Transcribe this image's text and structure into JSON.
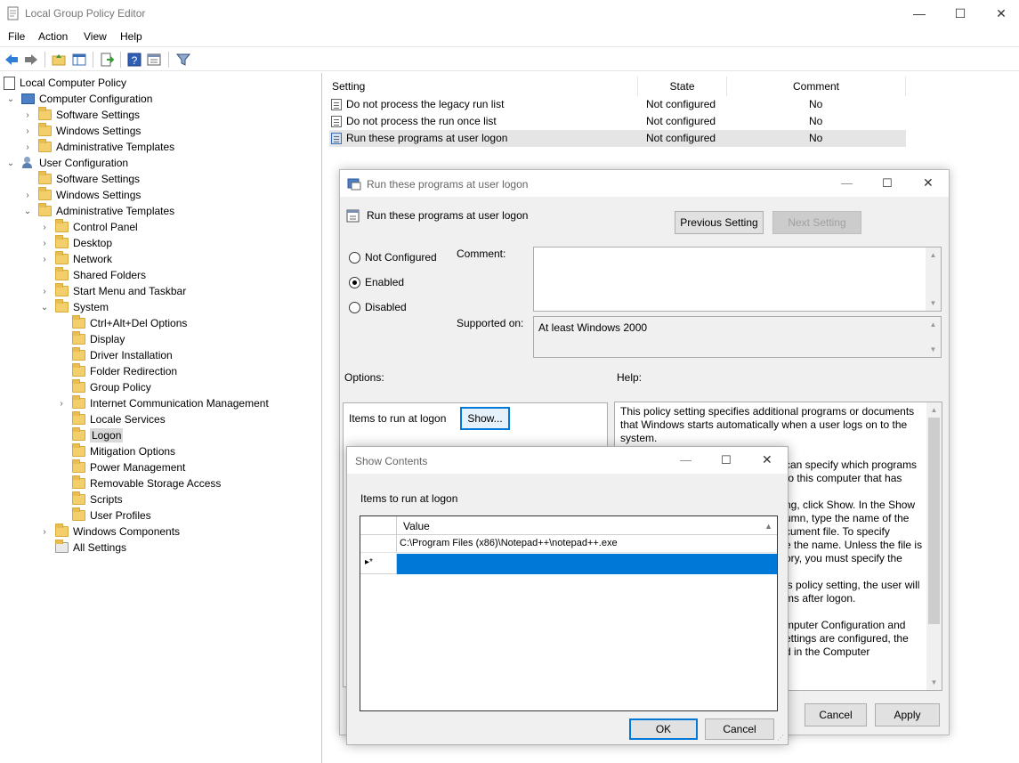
{
  "window": {
    "title": "Local Group Policy Editor",
    "controls": {
      "minimize": "—",
      "maximize": "☐",
      "close": "✕"
    }
  },
  "menu": [
    "File",
    "Action",
    "View",
    "Help"
  ],
  "tree": {
    "root": "Local Computer Policy",
    "computer_config": "Computer Configuration",
    "cc_software": "Software Settings",
    "cc_windows": "Windows Settings",
    "cc_admin": "Administrative Templates",
    "user_config": "User Configuration",
    "uc_software": "Software Settings",
    "uc_windows": "Windows Settings",
    "uc_admin": "Administrative Templates",
    "control_panel": "Control Panel",
    "desktop": "Desktop",
    "network": "Network",
    "shared_folders": "Shared Folders",
    "start_menu": "Start Menu and Taskbar",
    "system": "System",
    "ctrl_alt_del": "Ctrl+Alt+Del Options",
    "display": "Display",
    "driver_install": "Driver Installation",
    "folder_redirect": "Folder Redirection",
    "group_policy": "Group Policy",
    "icm": "Internet Communication Management",
    "locale": "Locale Services",
    "logon": "Logon",
    "mitigation": "Mitigation Options",
    "power": "Power Management",
    "removable": "Removable Storage Access",
    "scripts": "Scripts",
    "user_profiles": "User Profiles",
    "win_components": "Windows Components",
    "all_settings": "All Settings"
  },
  "list": {
    "headers": {
      "setting": "Setting",
      "state": "State",
      "comment": "Comment"
    },
    "rows": [
      {
        "setting": "Do not process the legacy run list",
        "state": "Not configured",
        "comment": "No"
      },
      {
        "setting": "Do not process the run once list",
        "state": "Not configured",
        "comment": "No"
      },
      {
        "setting": "Run these programs at user logon",
        "state": "Not configured",
        "comment": "No"
      }
    ]
  },
  "policy_dialog": {
    "title": "Run these programs at user logon",
    "heading": "Run these programs at user logon",
    "prev_button": "Previous Setting",
    "next_button": "Next Setting",
    "radio_not_configured": "Not Configured",
    "radio_enabled": "Enabled",
    "radio_disabled": "Disabled",
    "comment_label": "Comment:",
    "supported_label": "Supported on:",
    "supported_value": "At least Windows 2000",
    "options_label": "Options:",
    "help_label": "Help:",
    "items_label": "Items to run at logon",
    "show_button": "Show...",
    "help_lines": [
      "This policy setting specifies additional programs or documents",
      "that Windows starts automatically when a user logs on to the",
      "system.",
      "",
      "can specify which programs",
      "to this computer that has",
      "",
      "ng, click Show. In the Show",
      "umn, type the name of the",
      "cument file. To specify",
      "e the name. Unless the file is",
      "ory, you must specify the",
      "",
      "is policy setting, the user will",
      "ms after logon.",
      "",
      "mputer Configuration and",
      "ettings are configured, the",
      "d in the Computer"
    ],
    "cancel_button": "Cancel",
    "apply_button": "Apply"
  },
  "show_dialog": {
    "title": "Show Contents",
    "items_label": "Items to run at logon",
    "column": "Value",
    "rows": [
      "C:\\Program Files (x86)\\Notepad++\\notepad++.exe"
    ],
    "new_row_marker": "▸*",
    "ok_button": "OK",
    "cancel_button": "Cancel"
  }
}
